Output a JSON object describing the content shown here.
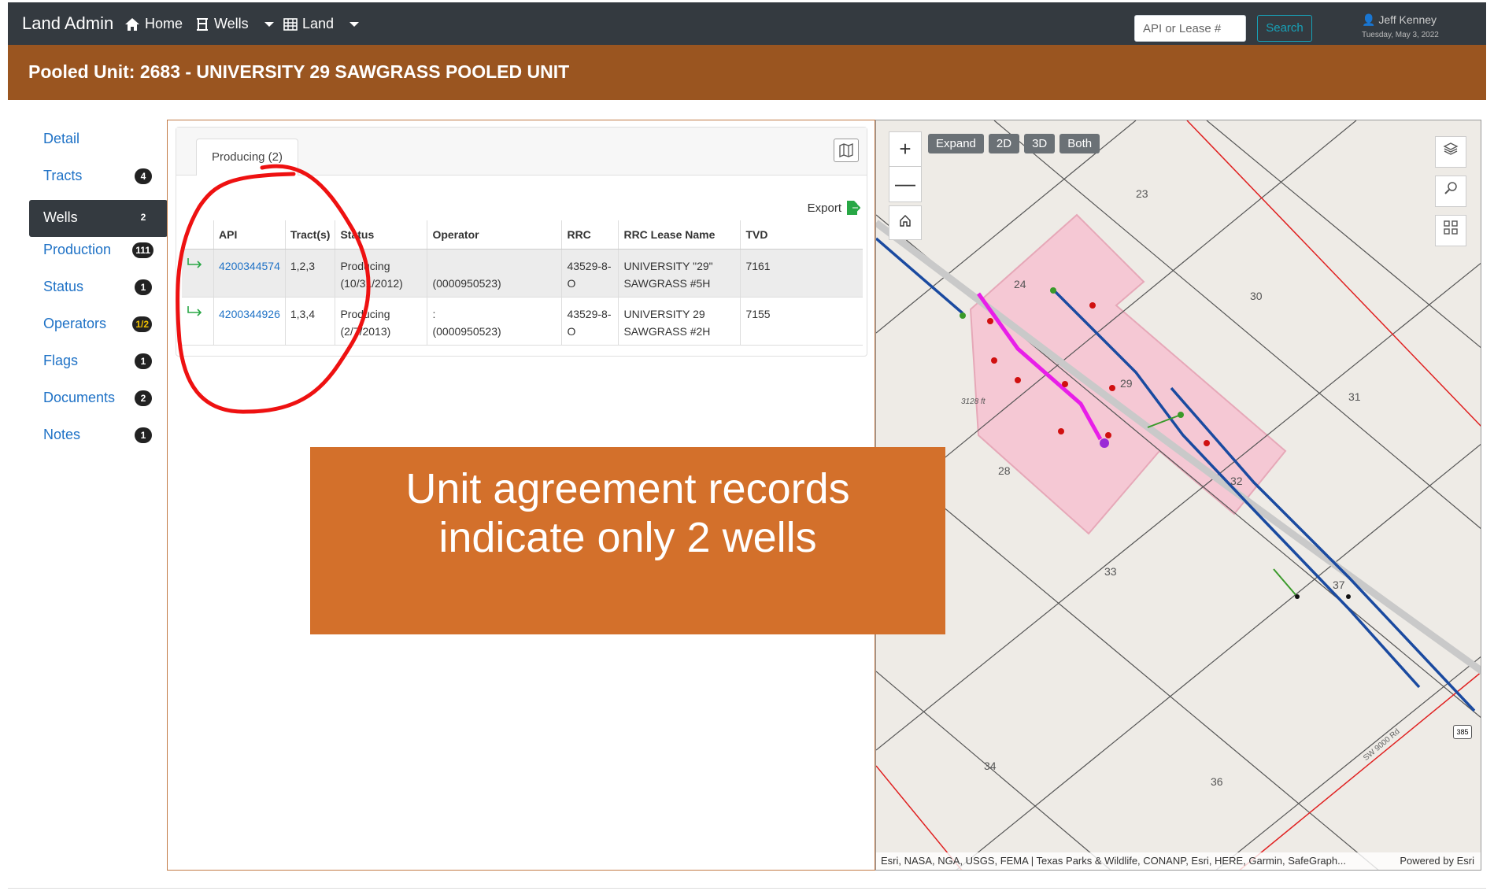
{
  "app": {
    "brand": "Land Admin"
  },
  "nav": {
    "home": "Home",
    "wells": "Wells",
    "land": "Land"
  },
  "search": {
    "placeholder": "API or Lease #",
    "button": "Search"
  },
  "user": {
    "name": "Jeff Kenney",
    "date": "Tuesday, May 3, 2022"
  },
  "page": {
    "title": "Pooled Unit: 2683 - UNIVERSITY 29 SAWGRASS POOLED UNIT"
  },
  "sidebar": {
    "items": [
      {
        "label": "Detail",
        "badge": ""
      },
      {
        "label": "Tracts",
        "badge": "4"
      },
      {
        "label": "Wells",
        "badge": "2"
      },
      {
        "label": "Production",
        "badge": "111"
      },
      {
        "label": "Status",
        "badge": "1"
      },
      {
        "label": "Operators",
        "badge": "1/2"
      },
      {
        "label": "Flags",
        "badge": "1"
      },
      {
        "label": "Documents",
        "badge": "2"
      },
      {
        "label": "Notes",
        "badge": "1"
      }
    ]
  },
  "wells_panel": {
    "tab": "Producing (2)",
    "export": "Export",
    "columns": [
      "API",
      "Tract(s)",
      "Status",
      "Operator",
      "RRC",
      "RRC Lease Name",
      "TVD"
    ],
    "rows": [
      {
        "api": "4200344574",
        "tracts": "1,2,3",
        "status1": "Producing",
        "status2": "(10/31/2012)",
        "operator1": "",
        "operator2": "(0000950523)",
        "rrc": "43529-8-O",
        "lease1": "UNIVERSITY \"29\"",
        "lease2": "SAWGRASS #5H",
        "tvd": "7161"
      },
      {
        "api": "4200344926",
        "tracts": "1,3,4",
        "status1": "Producing",
        "status2": "(2/7/2013)",
        "operator1": ":",
        "operator2": "(0000950523)",
        "rrc": "43529-8-O",
        "lease1": "UNIVERSITY 29",
        "lease2": "SAWGRASS #2H",
        "tvd": "7155"
      }
    ]
  },
  "map": {
    "buttons": [
      "Expand",
      "2D",
      "3D",
      "Both"
    ],
    "section_labels": [
      "23",
      "24",
      "30",
      "29",
      "31",
      "28",
      "32",
      "33",
      "37",
      "34",
      "36"
    ],
    "elevation": "3128 ft",
    "road_label": "SW 9000 Rd",
    "highway": "385",
    "attribution_left": "Esri, NASA, NGA, USGS, FEMA | Texas Parks & Wildlife, CONANP, Esri, HERE, Garmin, SafeGraph...",
    "attribution_right": "Powered by Esri"
  },
  "callout": {
    "line1": "Unit agreement records",
    "line2": "indicate only 2 wells"
  },
  "colors": {
    "topbar": "#343a40",
    "titlebar": "#9a5520",
    "callout": "#d3702b",
    "link": "#1f72c6"
  }
}
